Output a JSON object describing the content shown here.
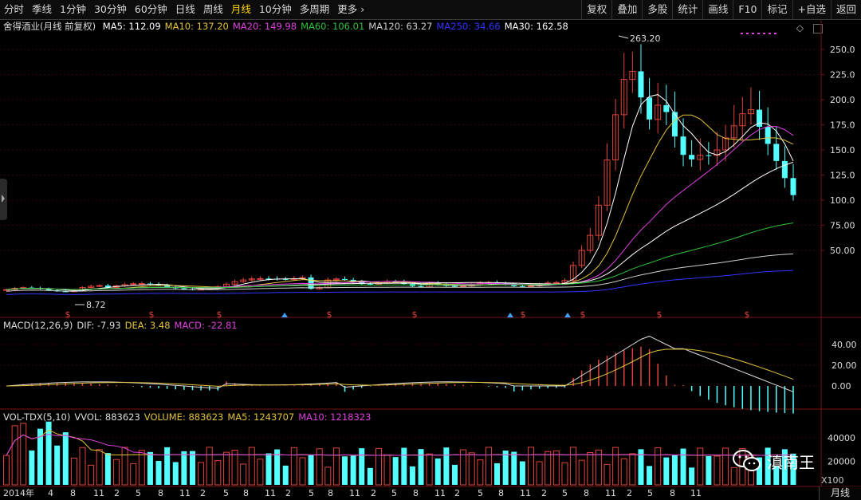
{
  "toolbar": {
    "left": [
      "分时",
      "季线",
      "1分钟",
      "30分钟",
      "60分钟",
      "日线",
      "周线",
      "月线",
      "10分钟",
      "多周期",
      "更多"
    ],
    "active": "月线",
    "right": [
      "复权",
      "叠加",
      "多股",
      "统计",
      "画线",
      "F10",
      "标记",
      "+自选",
      "返回"
    ]
  },
  "main_legend": {
    "title": "舍得酒业(月线 前复权)",
    "items": [
      {
        "label": "MA5: 112.09",
        "color": "#ffffff"
      },
      {
        "label": "MA10: 137.20",
        "color": "#e3c23c"
      },
      {
        "label": "MA20: 149.98",
        "color": "#e040e0"
      },
      {
        "label": "MA60: 106.01",
        "color": "#2ec23a"
      },
      {
        "label": "MA120: 63.27",
        "color": "#cfcfcf"
      },
      {
        "label": "MA250: 34.66",
        "color": "#3333ff"
      },
      {
        "label": "MA30: 162.58",
        "color": "#ffffff"
      }
    ]
  },
  "macd_legend": {
    "items": [
      {
        "label": "MACD(12,26,9)",
        "color": "#dddddd"
      },
      {
        "label": "DIF: -7.93",
        "color": "#dddddd"
      },
      {
        "label": "DEA: 3.48",
        "color": "#e3c23c"
      },
      {
        "label": "MACD: -22.81",
        "color": "#e040e0"
      }
    ]
  },
  "vol_legend": {
    "items": [
      {
        "label": "VOL-TDX(5,10)",
        "color": "#dddddd"
      },
      {
        "label": "VVOL: 883623",
        "color": "#dddddd"
      },
      {
        "label": "VOLUME: 883623",
        "color": "#e3c23c"
      },
      {
        "label": "MA5: 1243707",
        "color": "#e3c23c"
      },
      {
        "label": "MA10: 1218323",
        "color": "#e040e0"
      }
    ]
  },
  "annotations": {
    "high": "263.20",
    "low": "8.72"
  },
  "price_axis": [
    "250.0",
    "225.0",
    "200.0",
    "175.0",
    "150.0",
    "125.0",
    "100.0",
    "75.00",
    "50.00"
  ],
  "macd_axis": [
    "40.00",
    "20.00",
    "0.00"
  ],
  "vol_axis": [
    "40000",
    "20000"
  ],
  "vol_unit": "X100",
  "time_axis": [
    "2014年",
    "4",
    "8",
    "11",
    "2",
    "5",
    "8",
    "11",
    "2",
    "5",
    "8",
    "11",
    "2",
    "5",
    "8",
    "11",
    "2",
    "5",
    "8",
    "11",
    "2",
    "5",
    "8",
    "11",
    "2",
    "5",
    "8",
    "11",
    "2",
    "5",
    "8",
    "11"
  ],
  "period_button": "月线",
  "watermark": "滇南王",
  "colors": {
    "up": "#e0443c",
    "down": "#54ffff",
    "bg": "#000000",
    "grid": "#3a0000"
  }
}
